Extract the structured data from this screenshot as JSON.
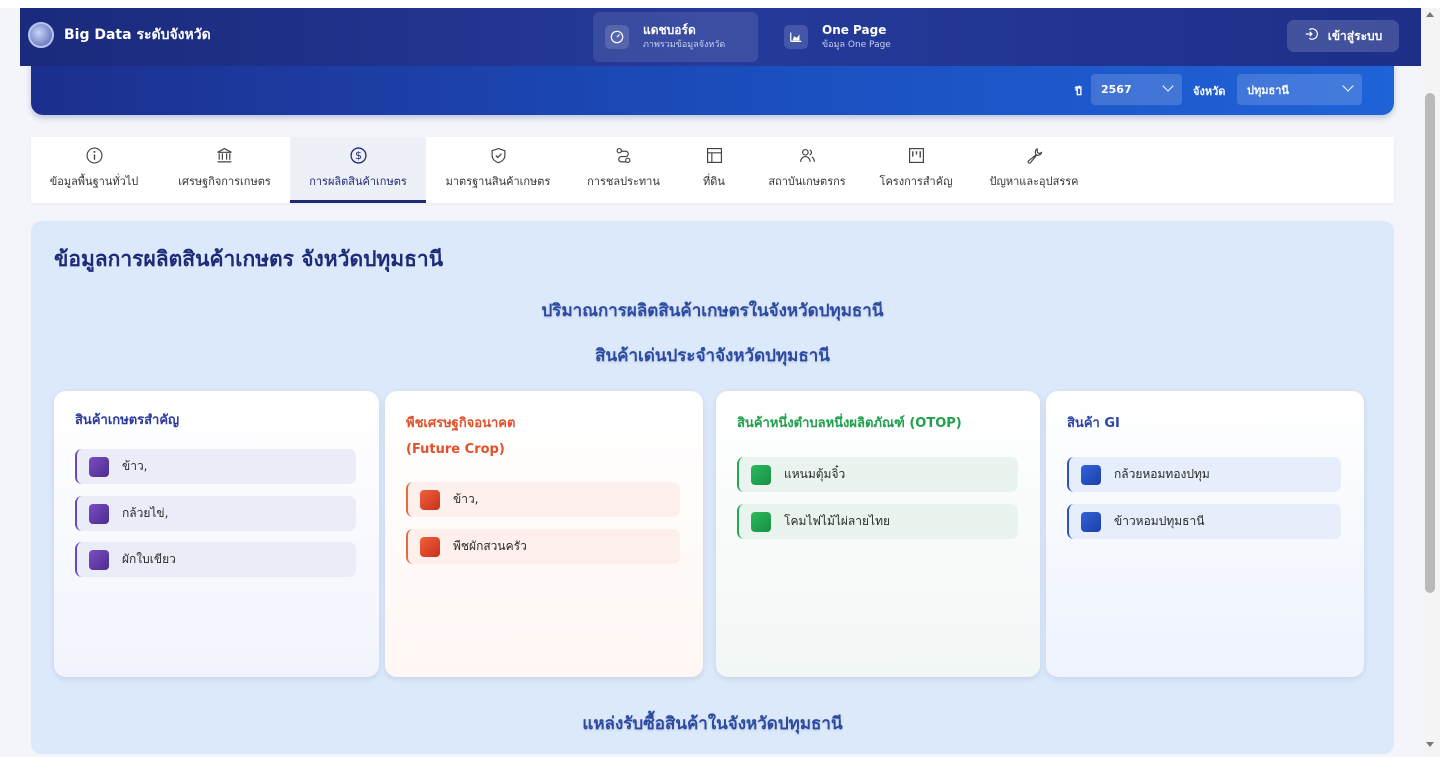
{
  "header": {
    "brand": "Big Data ระดับจังหวัด",
    "nav": [
      {
        "title": "แดชบอร์ด",
        "subtitle": "ภาพรวมข้อมูลจังหวัด"
      },
      {
        "title": "One Page",
        "subtitle": "ข้อมูล One Page"
      }
    ],
    "login_label": "เข้าสู่ระบบ"
  },
  "filters": {
    "year_label": "ปี",
    "year_value": "2567",
    "province_label": "จังหวัด",
    "province_value": "ปทุมธานี"
  },
  "tabs": [
    {
      "label": "ข้อมูลพื้นฐานทั่วไป",
      "icon": "info-icon"
    },
    {
      "label": "เศรษฐกิจการเกษตร",
      "icon": "bank-icon"
    },
    {
      "label": "การผลิตสินค้าเกษตร",
      "icon": "dollar-icon"
    },
    {
      "label": "มาตรฐานสินค้าเกษตร",
      "icon": "shield-check-icon"
    },
    {
      "label": "การชลประทาน",
      "icon": "route-icon"
    },
    {
      "label": "ที่ดิน",
      "icon": "layout-icon"
    },
    {
      "label": "สถาบันเกษตรกร",
      "icon": "users-icon"
    },
    {
      "label": "โครงการสำคัญ",
      "icon": "kanban-icon"
    },
    {
      "label": "ปัญหาและอุปสรรค",
      "icon": "wrench-icon"
    }
  ],
  "active_tab": "การผลิตสินค้าเกษตร",
  "content": {
    "page_title": "ข้อมูลการผลิตสินค้าเกษตร จังหวัดปทุมธานี",
    "production_title": "ปริมาณการผลิตสินค้าเกษตรในจังหวัดปทุมธานี",
    "featured_title": "สินค้าเด่นประจำจังหวัดปทุมธานี",
    "sources_title": "แหล่งรับซื้อสินค้าในจังหวัดปทุมธานี",
    "cards": [
      {
        "title": "สินค้าเกษตรสำคัญ",
        "items": [
          "ข้าว,",
          "กล้วยไข่,",
          "ผักใบเขียว"
        ],
        "color": "#6b48b8"
      },
      {
        "title": "พืชเศรษฐกิจอนาคต",
        "title2": "(Future Crop)",
        "items": [
          "ข้าว,",
          "พืชผักสวนครัว"
        ],
        "color": "#e0512a"
      },
      {
        "title": "สินค้าหนึ่งตำบลหนึ่งผลิตภัณฑ์ (OTOP)",
        "items": [
          "แหนมตุ้มจิ๋ว",
          "โคมไฟไม้ไผ่ลายไทย"
        ],
        "color": "#1ea04c"
      },
      {
        "title": "สินค้า GI",
        "items": [
          "กล้วยหอมทองปทุม",
          "ข้าวหอมปทุมธานี"
        ],
        "color": "#2d44a8"
      }
    ]
  }
}
